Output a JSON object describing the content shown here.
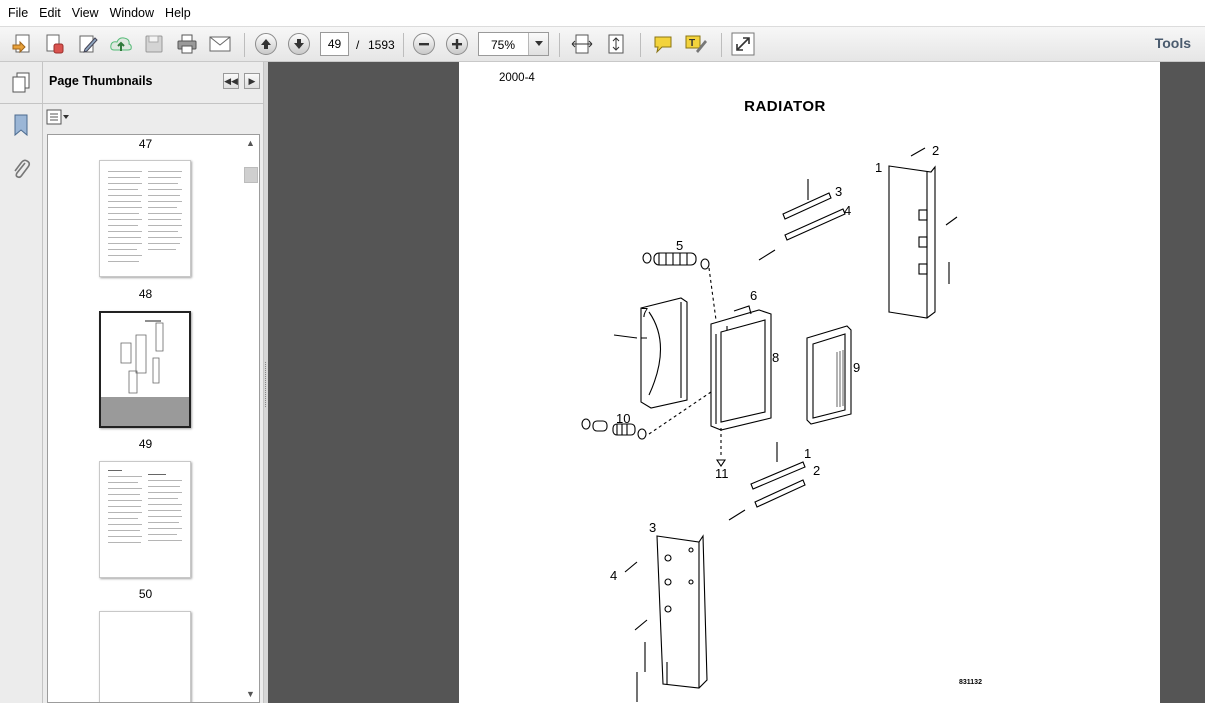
{
  "menu": [
    "File",
    "Edit",
    "View",
    "Window",
    "Help"
  ],
  "toolbar": {
    "current_page": "49",
    "page_separator": "/",
    "total_pages": "1593",
    "zoom": "75%",
    "tools_label": "Tools"
  },
  "sidebar": {
    "title": "Page Thumbnails"
  },
  "thumbnails": [
    {
      "label": "47"
    },
    {
      "label": "48"
    },
    {
      "label": "49"
    },
    {
      "label": "50"
    }
  ],
  "document": {
    "page_number": "2000-4",
    "title": "RADIATOR",
    "figure_number": "831132",
    "callouts": [
      "1",
      "2",
      "3",
      "4",
      "5",
      "6",
      "7",
      "8",
      "9",
      "10",
      "11",
      "1",
      "2",
      "3",
      "4"
    ]
  },
  "icons": {
    "toolbar": [
      "create-icon",
      "combine-icon",
      "edit-icon",
      "upload-icon",
      "save-icon",
      "print-icon",
      "email-icon",
      "prev-page-icon",
      "next-page-icon",
      "zoom-out-icon",
      "zoom-in-icon",
      "fit-width-icon",
      "fit-page-icon",
      "comment-icon",
      "highlight-text-icon",
      "fullscreen-icon"
    ],
    "rail": [
      "pages-icon",
      "bookmark-icon",
      "attachment-icon"
    ]
  }
}
